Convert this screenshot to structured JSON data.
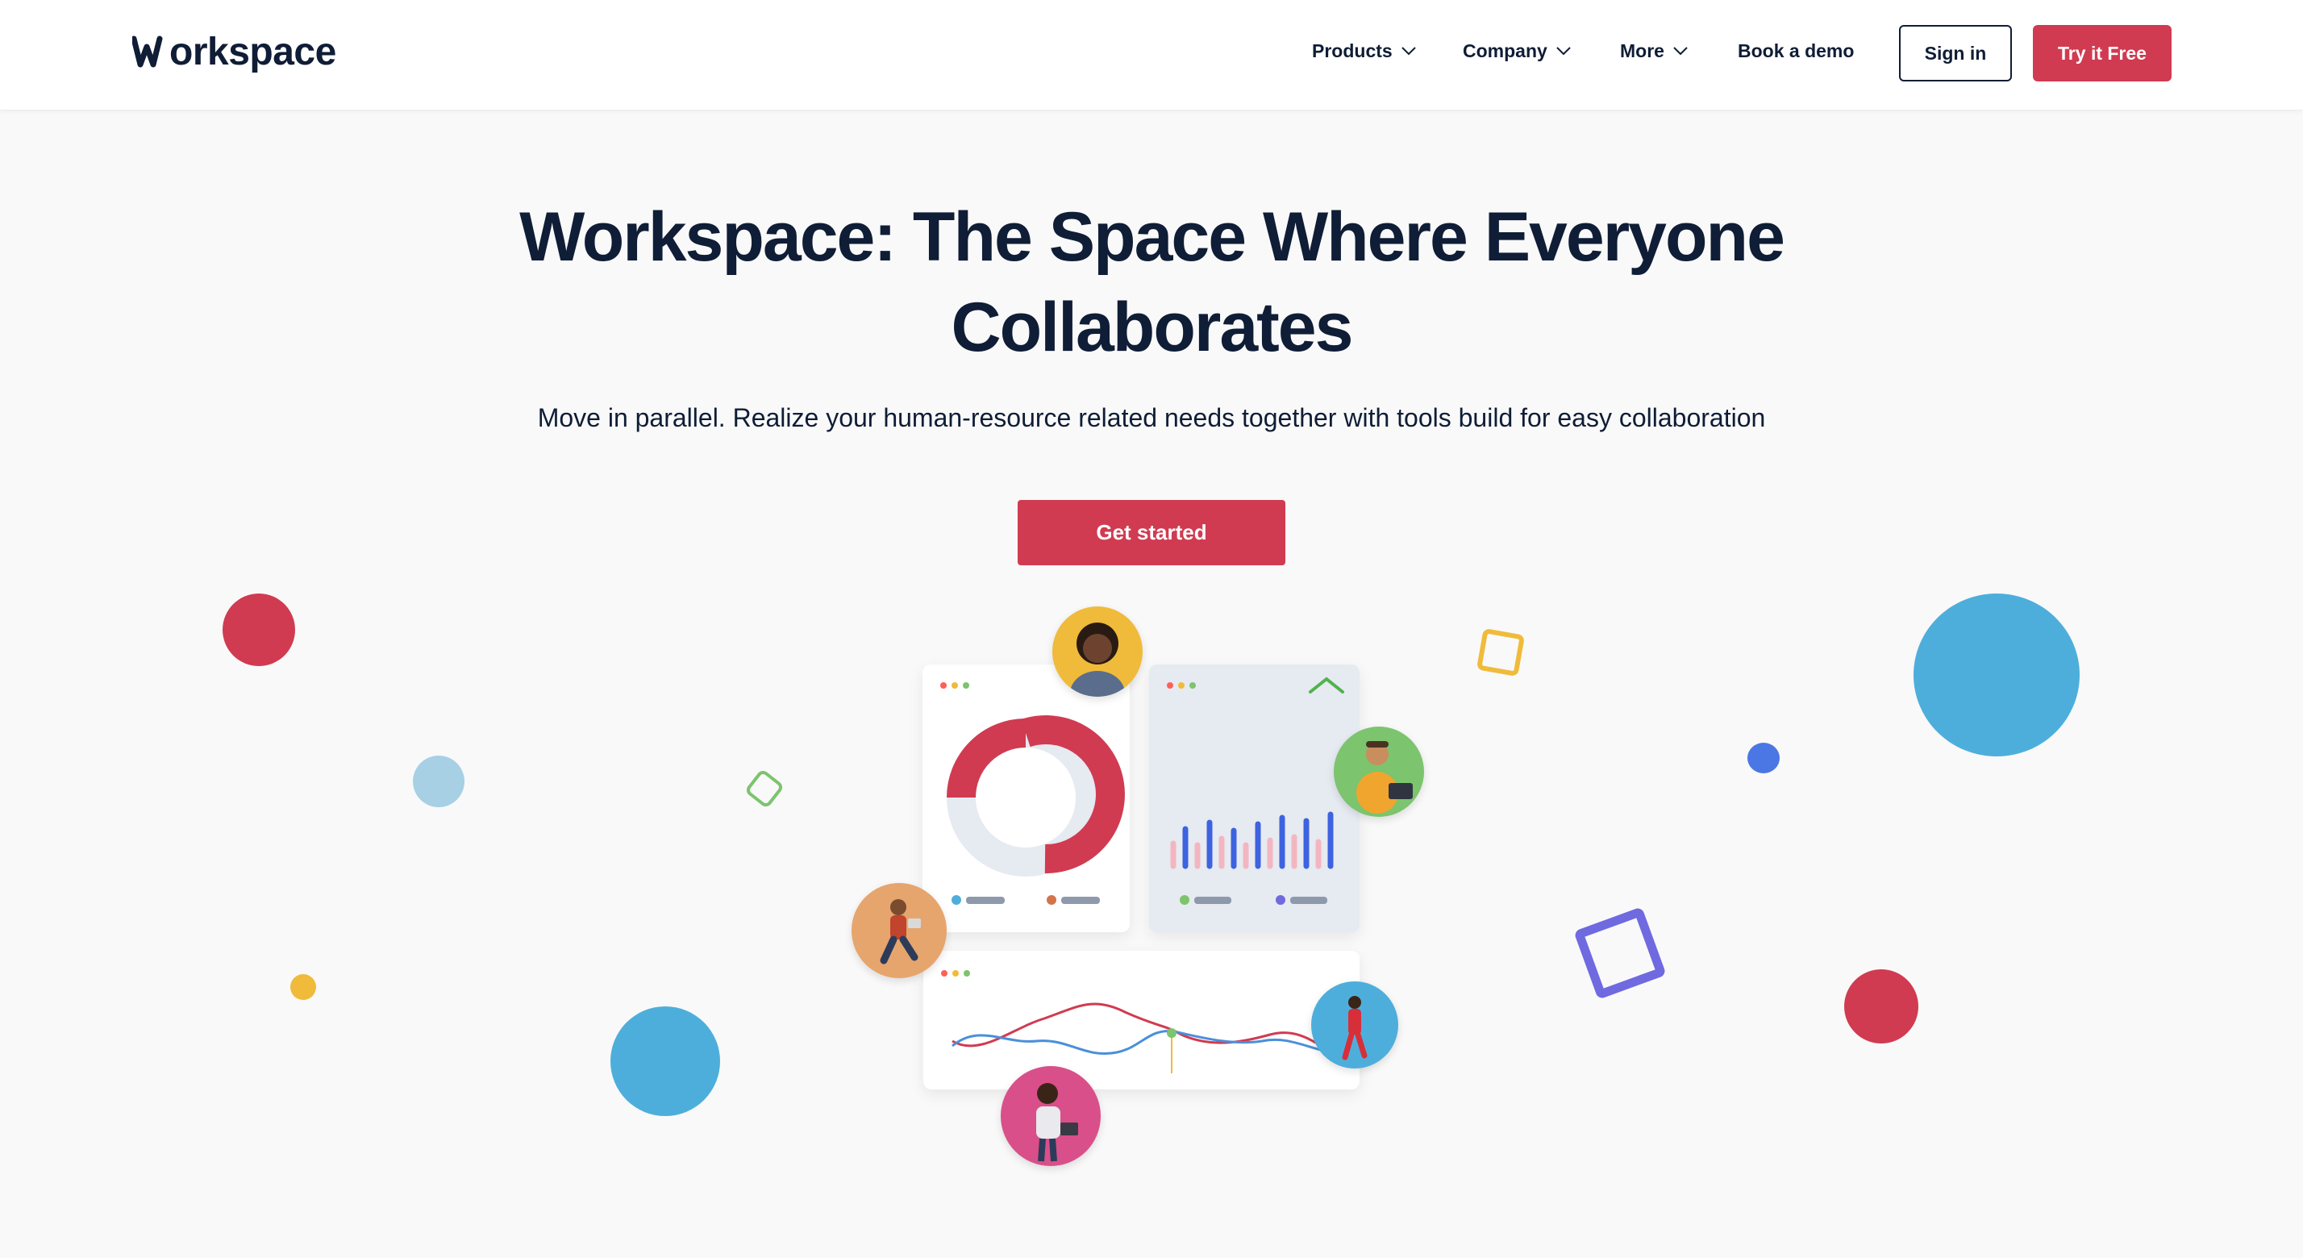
{
  "header": {
    "logo_text": "orkspace",
    "nav": [
      {
        "label": "Products"
      },
      {
        "label": "Company"
      },
      {
        "label": "More"
      },
      {
        "label": "Book a demo"
      }
    ],
    "sign_in": "Sign in",
    "try_free": "Try it Free"
  },
  "hero": {
    "title_line1": "Workspace: The Space Where Everyone",
    "title_line2": "Collaborates",
    "subtitle": "Move in parallel. Realize your human-resource related needs together with tools build for easy collaboration",
    "cta": "Get started"
  },
  "colors": {
    "brand_red": "#d03b51",
    "navy": "#0f1d36",
    "blue": "#4eaedb",
    "light_blue": "#a7d0e4",
    "yellow": "#f0bb3b",
    "purple": "#6f6ae0",
    "green": "#7cc46e"
  }
}
